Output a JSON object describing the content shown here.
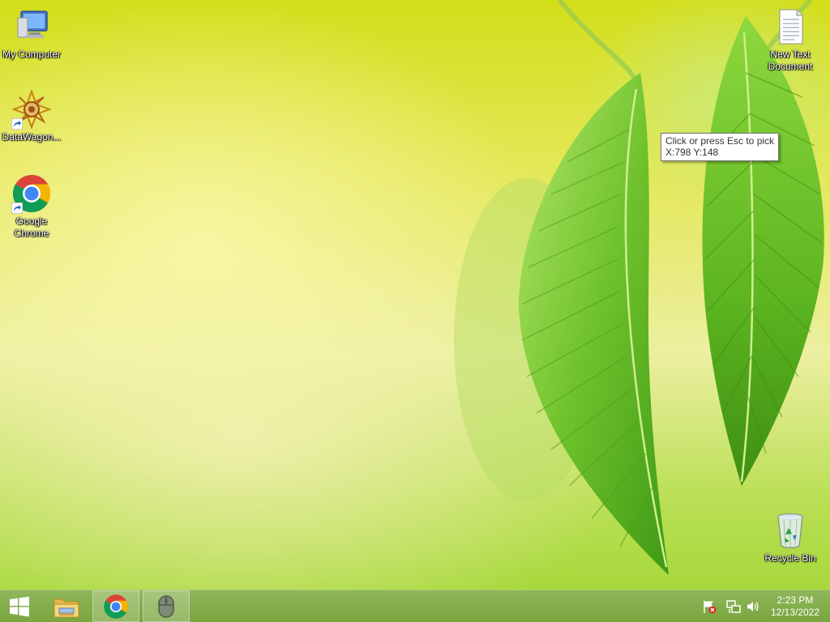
{
  "desktop": {
    "icons": [
      {
        "label": "My Computer",
        "icon": "computer-icon"
      },
      {
        "label": "DataWagon...",
        "icon": "datawagon-icon"
      },
      {
        "label": "Google Chrome",
        "icon": "chrome-icon"
      },
      {
        "label": "New Text Document",
        "icon": "text-document-icon"
      },
      {
        "label": "Recycle Bin",
        "icon": "recycle-bin-icon"
      }
    ]
  },
  "tooltip": {
    "line1": "Click or press Esc to pick",
    "line2": "X:798  Y:148"
  },
  "taskbar": {
    "start_icon": "windows-logo-icon",
    "pinned": [
      {
        "name": "file-explorer",
        "icon": "folder-icon"
      },
      {
        "name": "google-chrome",
        "icon": "chrome-icon"
      },
      {
        "name": "mouse-tool",
        "icon": "mouse-icon"
      }
    ],
    "tray": [
      {
        "icon": "action-center-flag-icon"
      },
      {
        "icon": "network-icon"
      },
      {
        "icon": "volume-icon"
      }
    ],
    "clock": {
      "time": "2:23 PM",
      "date": "12/13/2022"
    }
  },
  "colors": {
    "taskbar": "#7aa53f",
    "wallpaper_base": "#d3de1a",
    "leaf": "#6fbf2a"
  }
}
